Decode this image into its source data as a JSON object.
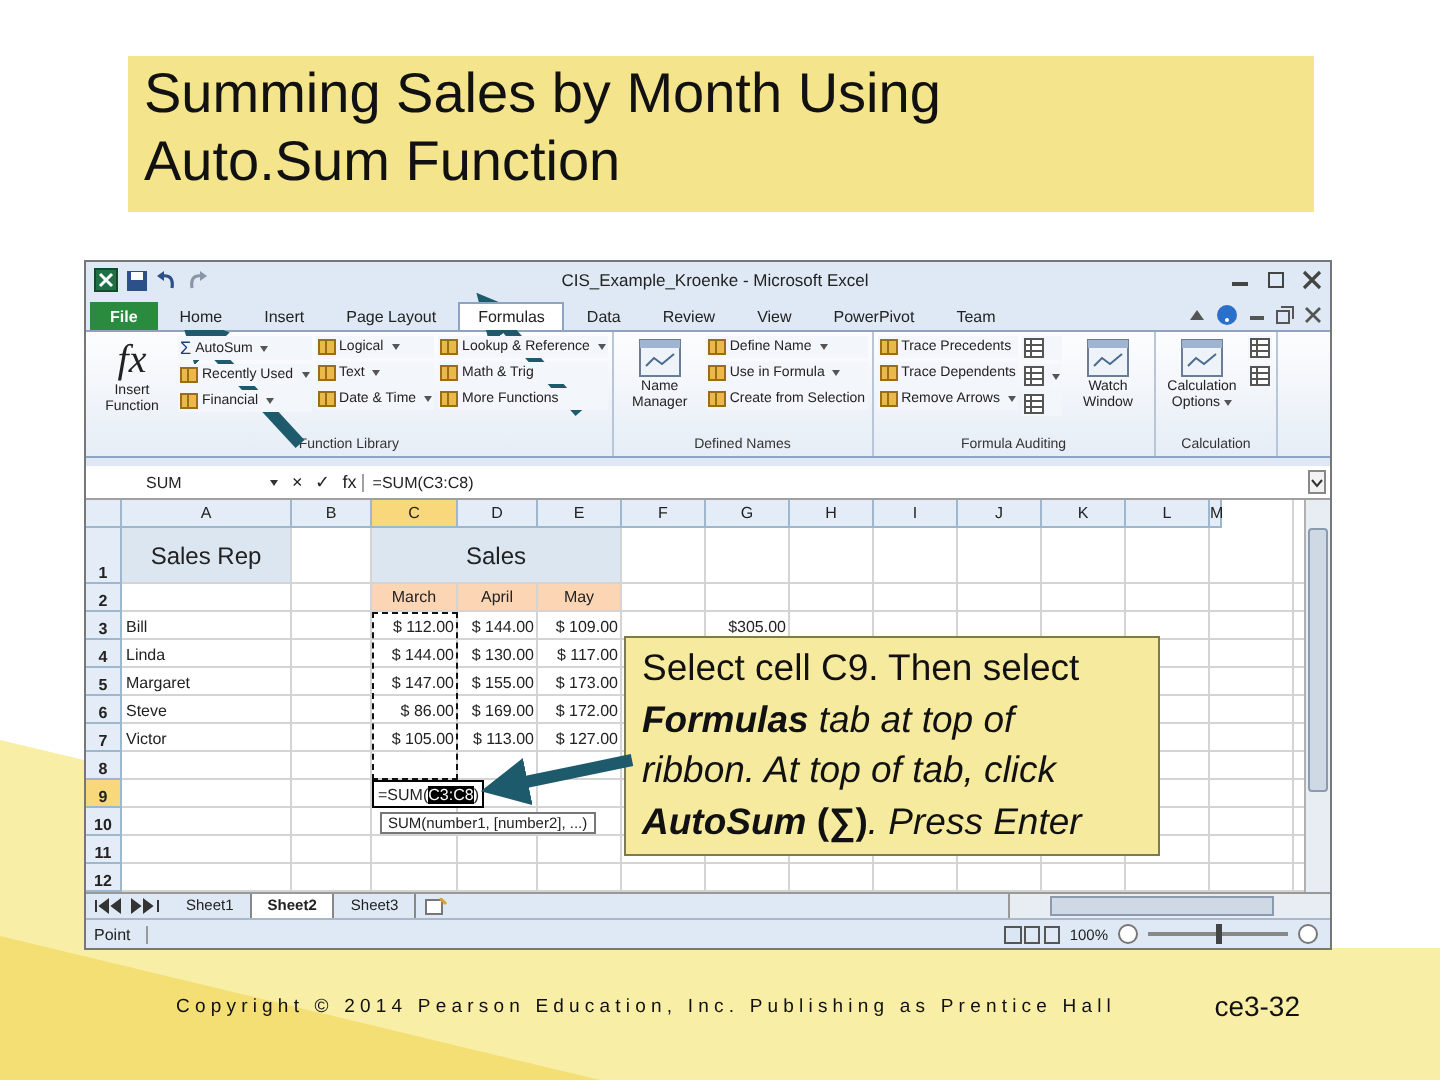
{
  "slide": {
    "title": "Summing Sales by Month Using Auto.Sum Function",
    "footer": "Copyright © 2014 Pearson Education, Inc. Publishing as Prentice Hall",
    "page_number": "ce3-32"
  },
  "window": {
    "title": "CIS_Example_Kroenke - Microsoft Excel"
  },
  "tabs": [
    {
      "label": "File",
      "kind": "file",
      "selected": false
    },
    {
      "label": "Home",
      "kind": "tab",
      "selected": false
    },
    {
      "label": "Insert",
      "kind": "tab",
      "selected": false
    },
    {
      "label": "Page Layout",
      "kind": "tab",
      "selected": false
    },
    {
      "label": "Formulas",
      "kind": "tab",
      "selected": true
    },
    {
      "label": "Data",
      "kind": "tab",
      "selected": false
    },
    {
      "label": "Review",
      "kind": "tab",
      "selected": false
    },
    {
      "label": "View",
      "kind": "tab",
      "selected": false
    },
    {
      "label": "PowerPivot",
      "kind": "tab",
      "selected": false
    },
    {
      "label": "Team",
      "kind": "tab",
      "selected": false
    }
  ],
  "ribbon": {
    "groups": [
      {
        "label": "Function Library",
        "columns": [
          [
            {
              "kind": "large",
              "label": "Insert Function",
              "glyph": "fx",
              "dropdown": false
            }
          ],
          [
            {
              "kind": "small",
              "label": "AutoSum",
              "glyph": "Σ",
              "dropdown": true
            },
            {
              "kind": "small",
              "label": "Recently Used",
              "dropdown": true
            },
            {
              "kind": "small",
              "label": "Financial",
              "dropdown": true
            }
          ],
          [
            {
              "kind": "small",
              "label": "Logical",
              "dropdown": true
            },
            {
              "kind": "small",
              "label": "Text",
              "dropdown": true
            },
            {
              "kind": "small",
              "label": "Date & Time",
              "dropdown": true
            }
          ],
          [
            {
              "kind": "small",
              "label": "Lookup & Reference",
              "dropdown": true
            },
            {
              "kind": "small",
              "label": "Math & Trig",
              "dropdown": false
            },
            {
              "kind": "small",
              "label": "More Functions",
              "dropdown": false
            }
          ]
        ]
      },
      {
        "label": "Defined Names",
        "columns": [
          [
            {
              "kind": "large",
              "label": "Name Manager",
              "dropdown": false
            }
          ],
          [
            {
              "kind": "small",
              "label": "Define Name",
              "dropdown": true
            },
            {
              "kind": "small",
              "label": "Use in Formula",
              "dropdown": true
            },
            {
              "kind": "small",
              "label": "Create from Selection",
              "dropdown": false
            }
          ]
        ]
      },
      {
        "label": "Formula Auditing",
        "columns": [
          [
            {
              "kind": "small",
              "label": "Trace Precedents",
              "dropdown": false
            },
            {
              "kind": "small",
              "label": "Trace Dependents",
              "dropdown": false
            },
            {
              "kind": "small",
              "label": "Remove Arrows",
              "dropdown": true
            }
          ],
          [
            {
              "kind": "icon",
              "dropdown": false
            },
            {
              "kind": "icon",
              "dropdown": true
            },
            {
              "kind": "icon",
              "dropdown": false
            }
          ],
          [
            {
              "kind": "large",
              "label": "Watch Window",
              "dropdown": false
            }
          ]
        ]
      },
      {
        "label": "Calculation",
        "columns": [
          [
            {
              "kind": "large",
              "label": "Calculation Options",
              "dropdown": true
            }
          ],
          [
            {
              "kind": "icon",
              "dropdown": false
            },
            {
              "kind": "icon",
              "dropdown": false
            }
          ]
        ]
      }
    ]
  },
  "formula_bar": {
    "name_box": "SUM",
    "buttons": [
      "×",
      "✓",
      "fx"
    ],
    "formula": "=SUM(C3:C8)"
  },
  "sheet": {
    "columns": [
      {
        "label": "A",
        "selected": false
      },
      {
        "label": "B",
        "selected": false
      },
      {
        "label": "C",
        "selected": true
      },
      {
        "label": "D",
        "selected": false
      },
      {
        "label": "E",
        "selected": false
      },
      {
        "label": "F",
        "selected": false
      },
      {
        "label": "G",
        "selected": false
      },
      {
        "label": "H",
        "selected": false
      },
      {
        "label": "I",
        "selected": false
      },
      {
        "label": "J",
        "selected": false
      },
      {
        "label": "K",
        "selected": false
      },
      {
        "label": "L",
        "selected": false
      },
      {
        "label": "M",
        "selected": false
      }
    ],
    "rows": [
      {
        "label": "1",
        "selected": false
      },
      {
        "label": "2",
        "selected": false
      },
      {
        "label": "3",
        "selected": false
      },
      {
        "label": "4",
        "selected": false
      },
      {
        "label": "5",
        "selected": false
      },
      {
        "label": "6",
        "selected": false
      },
      {
        "label": "7",
        "selected": false
      },
      {
        "label": "8",
        "selected": false
      },
      {
        "label": "9",
        "selected": true
      },
      {
        "label": "10",
        "selected": false
      },
      {
        "label": "11",
        "selected": false
      },
      {
        "label": "12",
        "selected": false
      }
    ],
    "header": {
      "sales_rep": "Sales Rep",
      "sales": "Sales"
    },
    "months": [
      "March",
      "April",
      "May"
    ],
    "data": [
      {
        "name": "Bill",
        "values": [
          "$ 112.00",
          "$ 144.00",
          "$ 109.00"
        ],
        "extra": "$305.00"
      },
      {
        "name": "Linda",
        "values": [
          "$ 144.00",
          "$ 130.00",
          "$ 117.00"
        ]
      },
      {
        "name": "Margaret",
        "values": [
          "$ 147.00",
          "$ 155.00",
          "$ 173.00"
        ]
      },
      {
        "name": "Steve",
        "values": [
          "$ 86.00",
          "$ 169.00",
          "$ 172.00"
        ]
      },
      {
        "name": "Victor",
        "values": [
          "$ 105.00",
          "$ 113.00",
          "$ 127.00"
        ]
      }
    ],
    "editing_cell": {
      "before": "=SUM(",
      "selection": "C3:C8",
      "after": ")"
    },
    "tooltip": "SUM(number1, [number2], ...)"
  },
  "sheet_tabs": [
    {
      "label": "Sheet1",
      "selected": false
    },
    {
      "label": "Sheet2",
      "selected": true
    },
    {
      "label": "Sheet3",
      "selected": false
    }
  ],
  "status_bar": {
    "mode": "Point",
    "zoom": "100%",
    "zoom_slider": {
      "level": 0.5
    }
  },
  "callout": {
    "segments": [
      {
        "text": "Select cell C9. Then select ",
        "bold": false,
        "italic": false
      },
      {
        "text": "Formulas",
        "bold": true,
        "italic": true
      },
      {
        "text": " tab at top of ribbon. At top of tab, click ",
        "bold": false,
        "italic": true
      },
      {
        "text": "AutoSum",
        "bold": true,
        "italic": true
      },
      {
        "text": " (∑)",
        "bold": true,
        "italic": false
      },
      {
        "text": ". Press Enter",
        "bold": false,
        "italic": true
      }
    ]
  }
}
